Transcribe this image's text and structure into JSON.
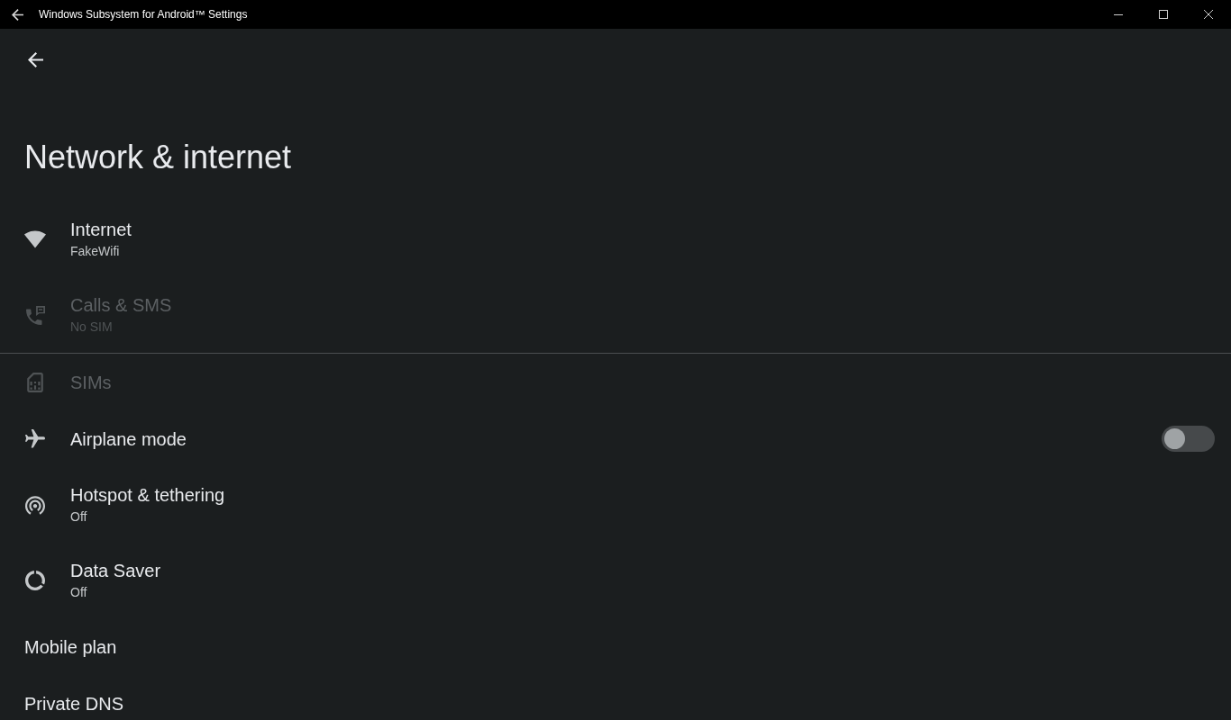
{
  "window": {
    "title": "Windows Subsystem for Android™ Settings"
  },
  "page": {
    "title": "Network & internet"
  },
  "sections": [
    {
      "items": [
        {
          "kind": "link",
          "title": "Internet",
          "summary": "FakeWifi",
          "disabled": false
        },
        {
          "kind": "link",
          "title": "Calls & SMS",
          "summary": "No SIM",
          "disabled": true
        }
      ]
    },
    {
      "items": [
        {
          "kind": "link",
          "title": "SIMs",
          "disabled": true
        },
        {
          "kind": "switch",
          "title": "Airplane mode",
          "disabled": false,
          "on": false
        },
        {
          "kind": "link",
          "title": "Hotspot & tethering",
          "summary": "Off",
          "disabled": false
        },
        {
          "kind": "link",
          "title": "Data Saver",
          "summary": "Off",
          "disabled": false
        },
        {
          "kind": "link",
          "title": "Mobile plan",
          "disabled": false
        },
        {
          "kind": "link",
          "title": "Private DNS",
          "disabled": false
        }
      ]
    }
  ]
}
